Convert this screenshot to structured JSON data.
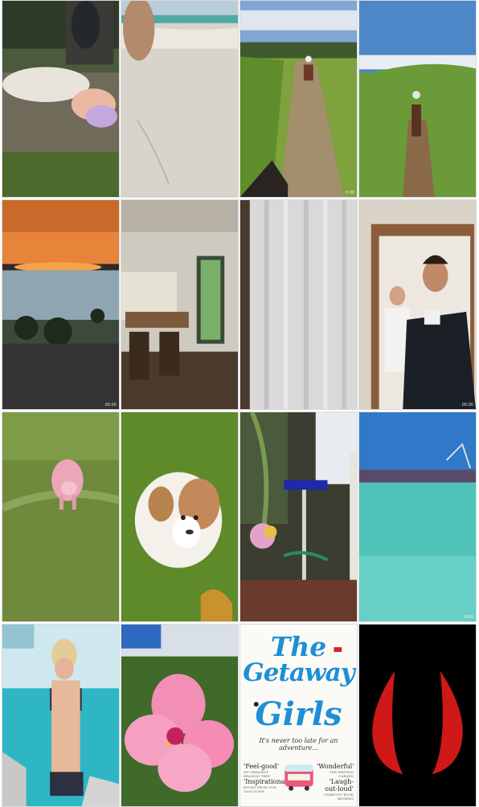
{
  "grid": {
    "tiles": [
      {
        "id": "woman-fountain",
        "kind": "video"
      },
      {
        "id": "beach-sand",
        "kind": "video"
      },
      {
        "id": "horse-trail-riders",
        "kind": "video"
      },
      {
        "id": "horse-rider-hills",
        "kind": "video"
      },
      {
        "id": "ocean-sunset",
        "kind": "video"
      },
      {
        "id": "interior-room",
        "kind": "video"
      },
      {
        "id": "sheer-curtains",
        "kind": "video"
      },
      {
        "id": "men-doorway",
        "kind": "video"
      },
      {
        "id": "pink-pig-grass",
        "kind": "video"
      },
      {
        "id": "puppy-grass",
        "kind": "video"
      },
      {
        "id": "patio-pole",
        "kind": "video"
      },
      {
        "id": "turquoise-lagoon",
        "kind": "video"
      },
      {
        "id": "woman-bikini-pool",
        "kind": "photo"
      },
      {
        "id": "pink-hibiscus",
        "kind": "photo"
      },
      {
        "id": "book-cover",
        "kind": "photo"
      },
      {
        "id": "red-horns",
        "kind": "photo"
      }
    ],
    "durations": {
      "t3": "0:00",
      "t5": "00:00",
      "t8": "00:00",
      "t12": "0:00"
    }
  },
  "book": {
    "title_line1": "The",
    "title_line2": "Getaway",
    "title_line3": "Girls",
    "tagline": "It's never too late for an adventure...",
    "quote_left": "'Feel-good'",
    "quote_left_small": "MY GREATEST READING TREE",
    "quote_left2": "'Inspirational!'",
    "quote_left2_small": "BOOKS FROM OUR TALE DOWN",
    "quote_right": "'Wonderful'",
    "quote_right_small": "THE WRITING GARDEN",
    "quote_right2": "'Laugh-out-loud'",
    "quote_right2_small": "STARDUST BOOK REVIEWS"
  },
  "colors": {
    "horns": "#d01818",
    "book_title": "#1e8fd6",
    "border": "#d9d9d9"
  }
}
